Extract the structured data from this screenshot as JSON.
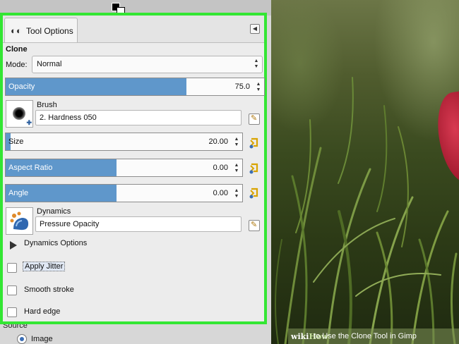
{
  "panel": {
    "tab_label": "Tool Options",
    "tool_name": "Clone",
    "mode": {
      "label": "Mode:",
      "value": "Normal"
    },
    "opacity": {
      "label": "Opacity",
      "value": "75.0",
      "fill": 0.7
    },
    "brush": {
      "title": "Brush",
      "value": "2. Hardness 050"
    },
    "size": {
      "label": "Size",
      "value": "20.00",
      "fill": 0.02
    },
    "aspect_ratio": {
      "label": "Aspect Ratio",
      "value": "0.00",
      "fill": 0.47
    },
    "angle": {
      "label": "Angle",
      "value": "0.00",
      "fill": 0.47
    },
    "dynamics": {
      "title": "Dynamics",
      "value": "Pressure Opacity"
    },
    "dynamics_options_label": "Dynamics Options",
    "checkboxes": [
      {
        "label": "Apply Jitter",
        "checked": false
      },
      {
        "label": "Smooth stroke",
        "checked": false
      },
      {
        "label": "Hard edge",
        "checked": false
      }
    ],
    "source": {
      "label": "Source",
      "option": "Image"
    }
  },
  "watermark": {
    "brand_wiki": "wiki",
    "brand_how": "How",
    "title": "to Use the Clone Tool in Gimp"
  },
  "colors": {
    "highlight_border": "#33e633",
    "slider_fill": "#5f97cb",
    "flower": "#c0223a"
  },
  "icons": {
    "tab": "tool-options-icon",
    "collapse": "collapse-icon",
    "reset": "reset-icon",
    "edit": "edit-icon"
  }
}
